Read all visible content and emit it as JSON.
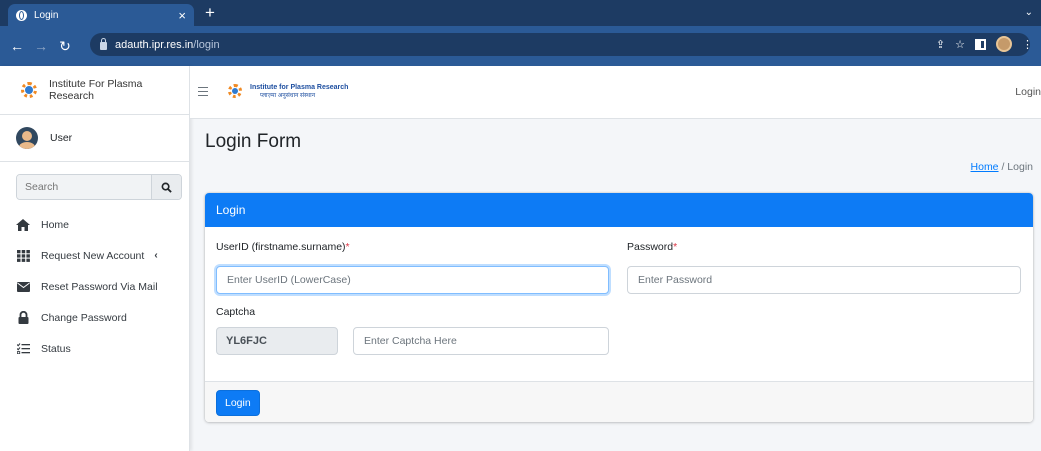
{
  "browser": {
    "tab_title": "Login",
    "tab_close": "×",
    "new_tab": "+",
    "url_host": "adauth.ipr.res.in",
    "url_path": "/login"
  },
  "sidebar": {
    "brand": "Institute For Plasma Research",
    "user": "User",
    "search_placeholder": "Search",
    "items": [
      {
        "label": "Home",
        "icon": "home-icon"
      },
      {
        "label": "Request New Account",
        "icon": "grid-icon",
        "caret": "‹"
      },
      {
        "label": "Reset Password Via Mail",
        "icon": "envelope-icon"
      },
      {
        "label": "Change Password",
        "icon": "lock-icon"
      },
      {
        "label": "Status",
        "icon": "list-check-icon"
      }
    ]
  },
  "topnav": {
    "logo_line1": "Institute for Plasma Research",
    "logo_line2": "प्लाज़्मा अनुसंधान संस्थान",
    "login": "Login"
  },
  "content": {
    "title": "Login Form",
    "breadcrumb_home": "Home",
    "breadcrumb_sep": "/",
    "breadcrumb_current": "Login"
  },
  "form": {
    "header": "Login",
    "userid_label": "UserID (firstname.surname)",
    "userid_placeholder": "Enter UserID (LowerCase)",
    "password_label": "Password",
    "password_placeholder": "Enter Password",
    "required_mark": "*",
    "captcha_label": "Captcha",
    "captcha_code": "YL6FJC",
    "captcha_placeholder": "Enter Captcha Here",
    "submit": "Login"
  },
  "colors": {
    "primary": "#0d7bf5",
    "chrome_dark": "#1d3b63",
    "chrome": "#2b5a96",
    "required": "#dc3545"
  }
}
